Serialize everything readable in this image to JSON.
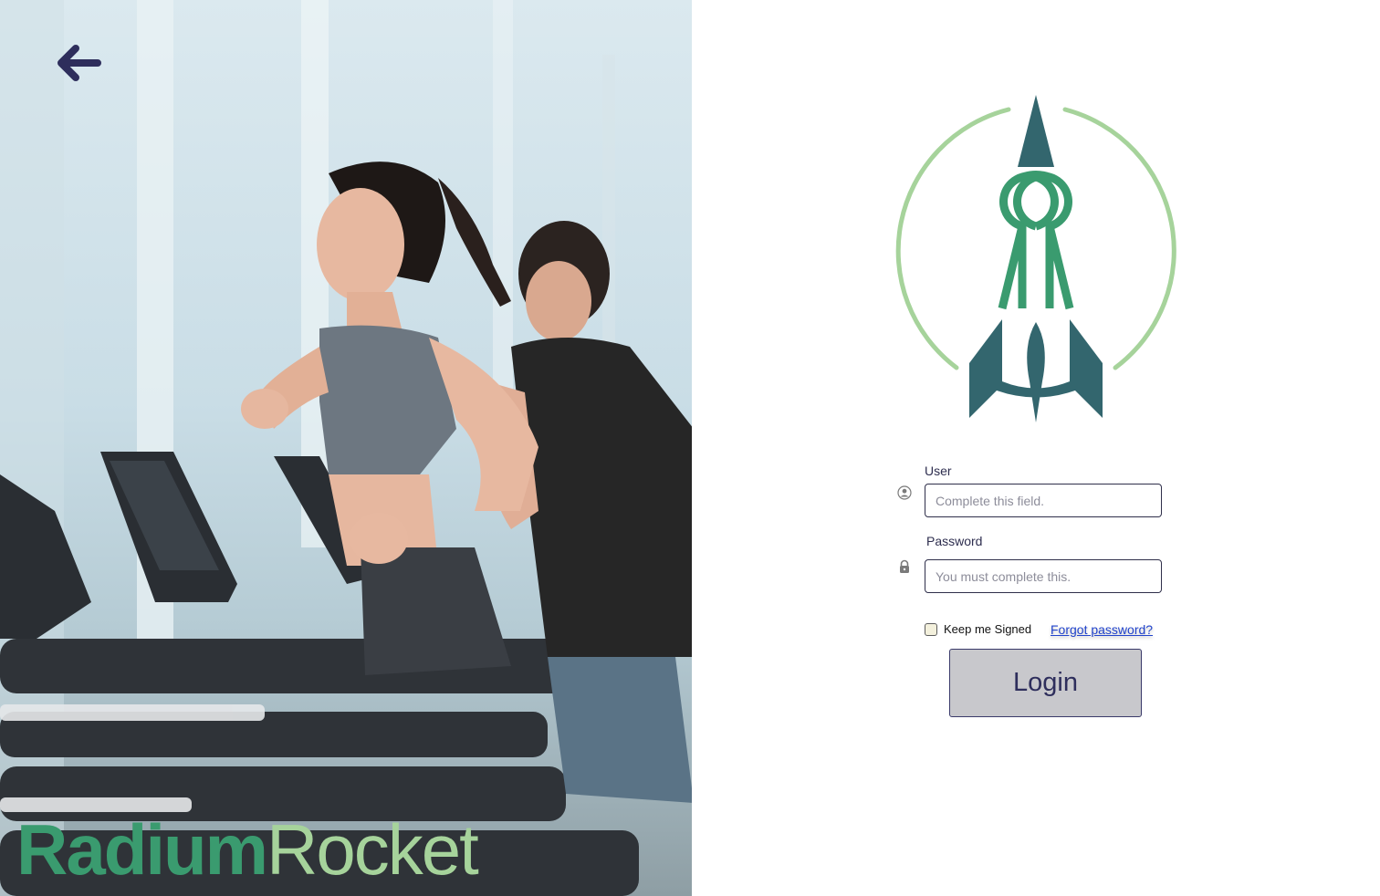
{
  "brand": {
    "bold_part": "Radium",
    "light_part": "Rocket"
  },
  "form": {
    "user_label": "User",
    "user_placeholder": "Complete this field.",
    "password_label": "Password",
    "password_placeholder": "You must complete this.",
    "keep_signed_label": "Keep me Signed",
    "forgot_password_label": "Forgot password?",
    "login_label": "Login"
  },
  "icons": {
    "back": "arrow-left-icon",
    "user": "user-icon",
    "password": "lock-icon",
    "logo": "rocket-logo"
  },
  "colors": {
    "primary_dark": "#2e2e5c",
    "brand_green": "#3a9b6f",
    "brand_light_green": "#a6d39b",
    "rocket_teal": "#33666e",
    "link": "#2244cc",
    "button_bg": "#c8c8cc"
  }
}
